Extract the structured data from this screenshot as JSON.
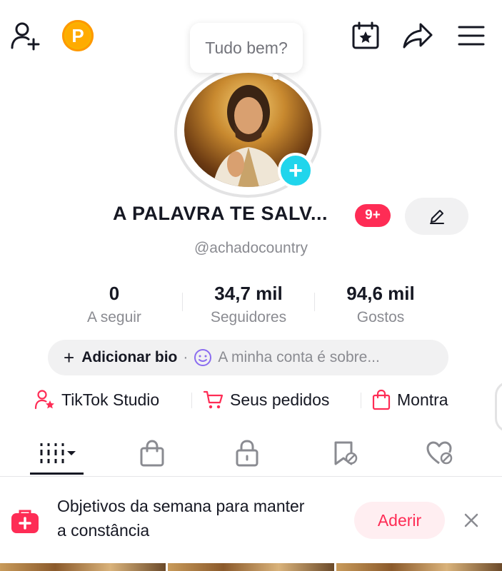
{
  "header": {
    "add_friend_icon": "person-add-icon",
    "coin_icon": "coin-icon",
    "coin_letter": "P",
    "calendar_icon": "calendar-star-icon",
    "share_icon": "share-arrow-icon",
    "menu_icon": "hamburger-menu-icon"
  },
  "status_bubble": {
    "text": "Tudo bem?"
  },
  "profile": {
    "display_name": "A PALAVRA TE SALV...",
    "notification_badge": "9+",
    "handle": "@achadocountry",
    "edit_icon": "pencil-icon"
  },
  "stats": [
    {
      "value": "0",
      "label": "A seguir"
    },
    {
      "value": "34,7 mil",
      "label": "Seguidores"
    },
    {
      "value": "94,6 mil",
      "label": "Gostos"
    }
  ],
  "bio": {
    "add_label": "Adicionar bio",
    "separator": "·",
    "placeholder": "A minha conta é sobre..."
  },
  "quick_links": [
    {
      "label": "TikTok Studio",
      "icon": "person-star-icon"
    },
    {
      "label": "Seus pedidos",
      "icon": "cart-icon"
    },
    {
      "label": "Montra",
      "icon": "shopping-bag-icon"
    }
  ],
  "tabs": [
    {
      "icon": "grid-icon",
      "active": true
    },
    {
      "icon": "bag-icon",
      "active": false
    },
    {
      "icon": "lock-icon",
      "active": false
    },
    {
      "icon": "bookmark-hidden-icon",
      "active": false
    },
    {
      "icon": "heart-hidden-icon",
      "active": false
    }
  ],
  "weekly_goal": {
    "text": "Objetivos da semana para manter a constância",
    "button_label": "Aderir",
    "icon": "medical-bag-plus-icon",
    "close_icon": "close-icon"
  },
  "colors": {
    "accent": "#fe2c55",
    "add_photo": "#20d5ec",
    "coin": "#f7b500",
    "text_primary": "#161823",
    "text_secondary": "#8a8b91"
  }
}
